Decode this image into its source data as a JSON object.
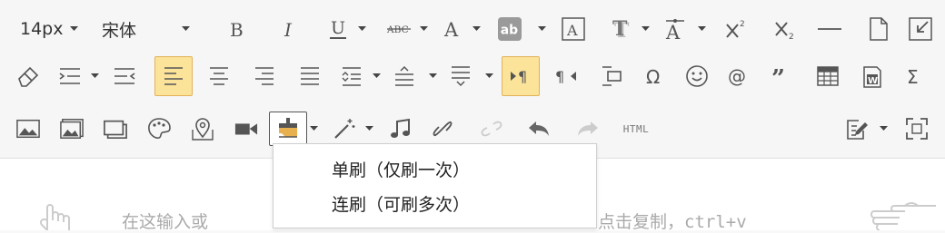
{
  "toolbar": {
    "font_size": "14px",
    "font_family": "宋体",
    "html_label": "HTML",
    "icons": {
      "bold": "bold-icon",
      "italic": "italic-icon",
      "underline": "underline-icon",
      "strikethrough": "strikethrough-icon",
      "font_color": "font-color-icon",
      "highlight": "highlight-icon",
      "border_text": "border-text-icon",
      "text_shadow": "text-shadow-icon",
      "text_effect": "text-effect-icon",
      "superscript": "superscript-icon",
      "subscript": "subscript-icon",
      "horizontal_rule": "horizontal-rule-icon",
      "new_page": "new-page-icon",
      "exit_fullscreen": "exit-fullscreen-icon",
      "eraser": "eraser-icon",
      "indent": "indent-icon",
      "align_left": "align-left-icon",
      "format_painter": "format-painter-icon",
      "html": "html-icon"
    },
    "highlight_bg": "#999999",
    "active_bg": "#fbe39a",
    "active_border": "#e3b25a"
  },
  "format_painter_menu": {
    "items": [
      {
        "label": "单刷（仅刷一次）"
      },
      {
        "label": "连刷（可刷多次）"
      }
    ]
  },
  "editor": {
    "placeholder_left": "在这输入或",
    "placeholder_right": "点击复制，ctrl+v"
  }
}
